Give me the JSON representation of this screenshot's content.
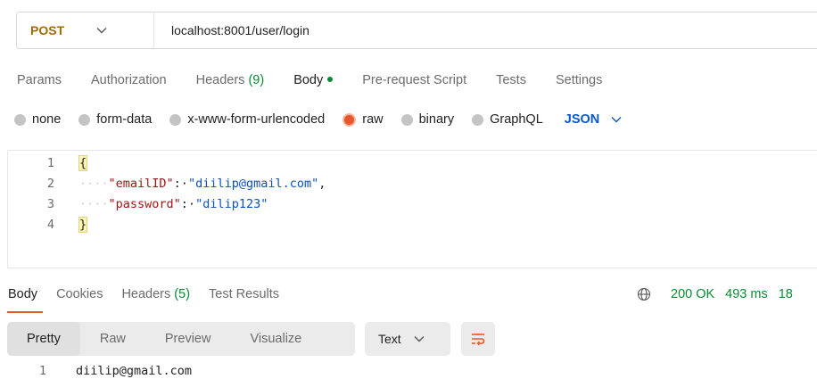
{
  "request": {
    "method": "POST",
    "method_color": "#a36a00",
    "url": "localhost:8001/user/login"
  },
  "req_tabs": [
    {
      "label": "Params",
      "count": null,
      "active": false
    },
    {
      "label": "Authorization",
      "count": null,
      "active": false
    },
    {
      "label": "Headers",
      "count": "(9)",
      "active": false
    },
    {
      "label": "Body",
      "count": null,
      "active": true,
      "dot_color": "#0a8a34"
    },
    {
      "label": "Pre-request Script",
      "count": null,
      "active": false
    },
    {
      "label": "Tests",
      "count": null,
      "active": false
    },
    {
      "label": "Settings",
      "count": null,
      "active": false
    }
  ],
  "body_modes": [
    {
      "label": "none",
      "selected": false
    },
    {
      "label": "form-data",
      "selected": false
    },
    {
      "label": "x-www-form-urlencoded",
      "selected": false
    },
    {
      "label": "raw",
      "selected": true
    },
    {
      "label": "binary",
      "selected": false
    },
    {
      "label": "GraphQL",
      "selected": false
    }
  ],
  "body_format": "JSON",
  "editor": {
    "lines": [
      {
        "num": "1",
        "open_brace": "{"
      },
      {
        "num": "2",
        "indent": "····",
        "key": "\"emailID\"",
        "sep": ":·",
        "value": "\"diilip@gmail.com\"",
        "trail": ","
      },
      {
        "num": "3",
        "indent": "····",
        "key": "\"password\"",
        "sep": ":·",
        "value": "\"dilip123\"",
        "trail": ""
      },
      {
        "num": "4",
        "close_brace": "}"
      }
    ]
  },
  "resp_tabs": [
    {
      "label": "Body",
      "count": null,
      "active": true
    },
    {
      "label": "Cookies",
      "count": null,
      "active": false
    },
    {
      "label": "Headers",
      "count": "(5)",
      "active": false
    },
    {
      "label": "Test Results",
      "count": null,
      "active": false
    }
  ],
  "response_status": {
    "icon": "globe-icon",
    "status": "200 OK",
    "time": "493 ms",
    "size": "18"
  },
  "view_modes": [
    "Pretty",
    "Raw",
    "Preview",
    "Visualize"
  ],
  "active_view": "Pretty",
  "language": "Text",
  "response_body": [
    {
      "num": "1",
      "text": "diilip@gmail.com"
    }
  ],
  "colors": {
    "accent_orange": "#e9562d",
    "success_green": "#0a8a34",
    "link_blue": "#0b57d0"
  }
}
